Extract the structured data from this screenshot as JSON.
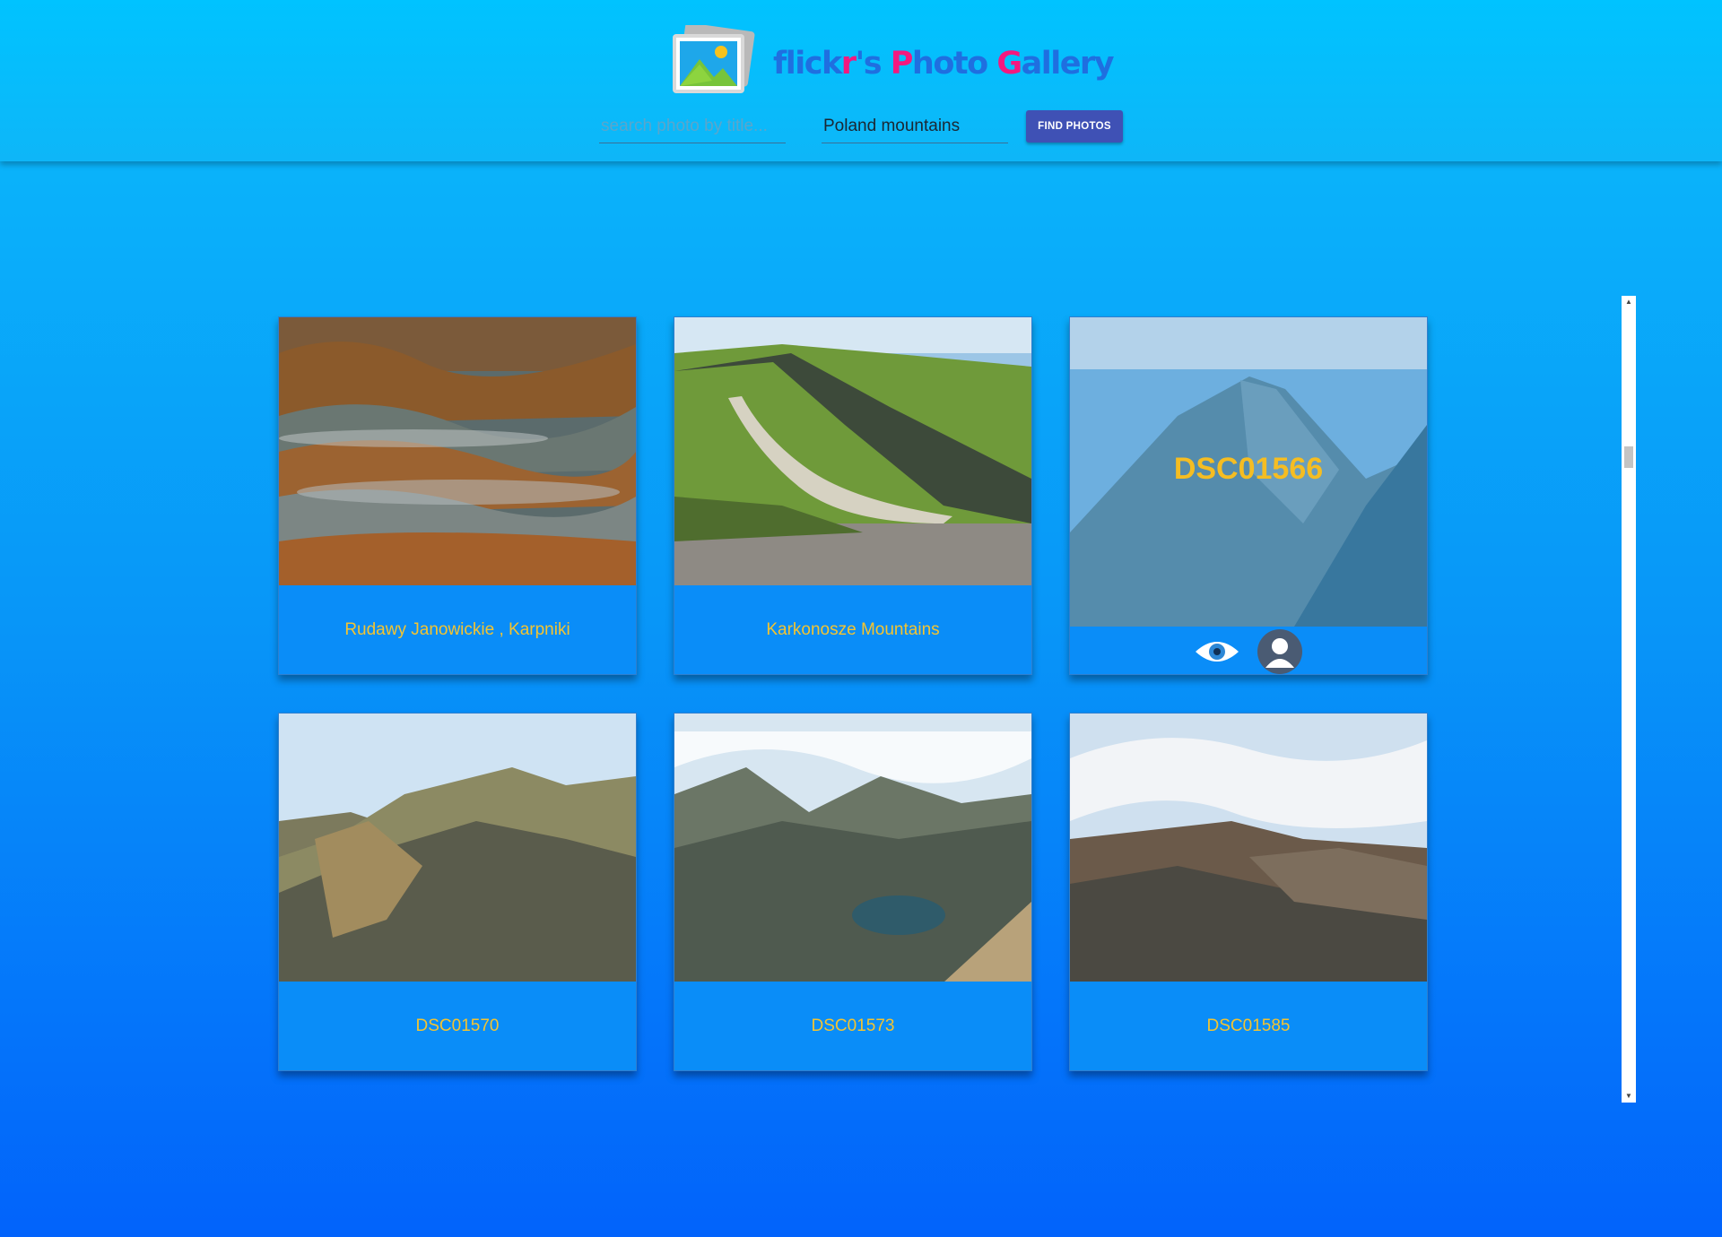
{
  "app": {
    "title_parts": [
      "flick",
      "r",
      "'s ",
      "P",
      "hoto ",
      "G",
      "allery"
    ]
  },
  "search": {
    "title_placeholder": "search photo by title...",
    "title_value": "",
    "tags_value": "Poland mountains",
    "find_button_label": "FIND PHOTOS"
  },
  "colors": {
    "header": "#00c3ff",
    "accent_pink": "#f4197f",
    "title_blue": "#1e74e6",
    "button": "#3f51b5",
    "caption_text": "#f4c430",
    "card_bg": "#0a8df8"
  },
  "photos": [
    {
      "caption": "Rudawy Janowickie , Karpniki",
      "scene": "autumn-fog-valley"
    },
    {
      "caption": "Karkonosze Mountains",
      "scene": "ridge-path"
    },
    {
      "caption": "DSC01566",
      "scene": "peak",
      "state": "hover",
      "actions": [
        "eye-icon",
        "user-icon"
      ]
    },
    {
      "caption": "DSC01570",
      "scene": "rocky-ridge"
    },
    {
      "caption": "DSC01573",
      "scene": "lake-valley"
    },
    {
      "caption": "DSC01585",
      "scene": "cloud-ridge"
    }
  ]
}
